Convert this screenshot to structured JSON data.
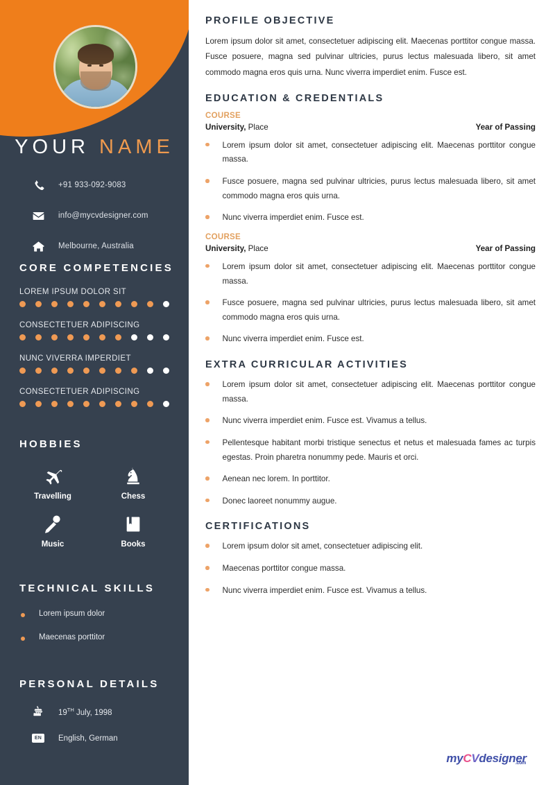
{
  "profile": {
    "name_first": "YOUR",
    "name_last": "NAME",
    "photo_alt": "profile-photo"
  },
  "contact": [
    {
      "icon": "phone-icon",
      "value": "+91 933-092-9083"
    },
    {
      "icon": "envelope-icon",
      "value": "info@mycvdesigner.com"
    },
    {
      "icon": "home-icon",
      "value": "Melbourne, Australia"
    }
  ],
  "core_competencies": {
    "heading": "CORE COMPETENCIES",
    "total_dots": 10,
    "items": [
      {
        "label": "LOREM IPSUM DOLOR SIT",
        "filled": 9
      },
      {
        "label": "CONSECTETUER ADIPISCING",
        "filled": 7
      },
      {
        "label": "NUNC VIVERRA IMPERDIET",
        "filled": 8
      },
      {
        "label": "CONSECTETUER ADIPISCING",
        "filled": 9
      }
    ]
  },
  "hobbies": {
    "heading": "HOBBIES",
    "items": [
      {
        "icon": "airplane-icon",
        "label": "Travelling"
      },
      {
        "icon": "chess-knight-icon",
        "label": "Chess"
      },
      {
        "icon": "microphone-icon",
        "label": "Music"
      },
      {
        "icon": "book-icon",
        "label": "Books"
      }
    ]
  },
  "technical_skills": {
    "heading": "TECHNICAL SKILLS",
    "items": [
      "Lorem ipsum dolor",
      "Maecenas porttitor"
    ]
  },
  "personal_details": {
    "heading": "PERSONAL DETAILS",
    "birthday": {
      "icon": "cake-icon",
      "day": "19",
      "ordinal": "TH",
      "rest": " July, 1998"
    },
    "languages": {
      "icon": "language-badge",
      "badge": "EN",
      "value": "English, German"
    }
  },
  "main": {
    "profile_objective": {
      "heading": "PROFILE OBJECTIVE",
      "text": "Lorem ipsum dolor sit amet, consectetuer adipiscing elit. Maecenas porttitor congue massa. Fusce posuere, magna sed pulvinar ultricies, purus lectus malesuada libero, sit amet commodo magna eros quis urna. Nunc viverra imperdiet enim. Fusce est."
    },
    "education": {
      "heading": "EDUCATION & CREDENTIALS",
      "entries": [
        {
          "course": "COURSE",
          "university": "University,",
          "place": " Place",
          "year": "Year of Passing",
          "bullets": [
            "Lorem ipsum dolor sit amet, consectetuer adipiscing elit. Maecenas porttitor congue massa.",
            "Fusce posuere, magna sed pulvinar ultricies, purus lectus malesuada libero, sit amet commodo magna eros quis urna.",
            "Nunc viverra imperdiet enim. Fusce est."
          ]
        },
        {
          "course": "COURSE",
          "university": "University,",
          "place": " Place",
          "year": "Year of Passing",
          "bullets": [
            "Lorem ipsum dolor sit amet, consectetuer adipiscing elit. Maecenas porttitor congue massa.",
            "Fusce posuere, magna sed pulvinar ultricies, purus lectus malesuada libero, sit amet commodo magna eros quis urna.",
            "Nunc viverra imperdiet enim. Fusce est."
          ]
        }
      ]
    },
    "extra_curricular": {
      "heading": "EXTRA CURRICULAR ACTIVITIES",
      "bullets": [
        "Lorem ipsum dolor sit amet, consectetuer adipiscing elit. Maecenas porttitor congue massa.",
        "Nunc viverra imperdiet enim. Fusce est. Vivamus a tellus.",
        "Pellentesque habitant morbi tristique senectus et netus et malesuada fames ac turpis egestas. Proin pharetra nonummy pede. Mauris et orci.",
        "Aenean nec lorem. In porttitor.",
        "Donec laoreet nonummy augue."
      ]
    },
    "certifications": {
      "heading": "CERTIFICATIONS",
      "bullets": [
        "Lorem ipsum dolor sit amet, consectetuer adipiscing elit.",
        "Maecenas porttitor congue massa.",
        "Nunc viverra imperdiet enim. Fusce est. Vivamus a tellus."
      ]
    }
  },
  "logo": {
    "part_my": "my",
    "part_c": "C",
    "part_v": "V",
    "part_designer": "designer",
    "part_com": ".com"
  },
  "colors": {
    "sidebar_bg": "#36414f",
    "orange": "#ef7e1b",
    "accent_orange": "#ef9a54",
    "course_orange": "#e2a05f",
    "text_dark": "#2b2b2b"
  }
}
